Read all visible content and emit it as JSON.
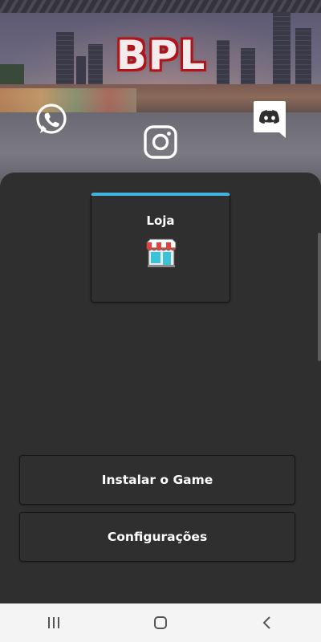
{
  "header": {
    "logo_text": "BPL",
    "social": {
      "whatsapp_icon": "whatsapp-icon",
      "instagram_icon": "instagram-icon",
      "discord_icon": "discord-icon"
    }
  },
  "main": {
    "shop_card": {
      "title": "Loja",
      "icon": "store-icon",
      "accent_color": "#3fb4e0"
    },
    "buttons": [
      {
        "label": "Instalar o Game"
      },
      {
        "label": "Configurações"
      }
    ]
  },
  "navbar": {
    "items": [
      "recent-apps-icon",
      "home-icon",
      "back-icon"
    ]
  }
}
